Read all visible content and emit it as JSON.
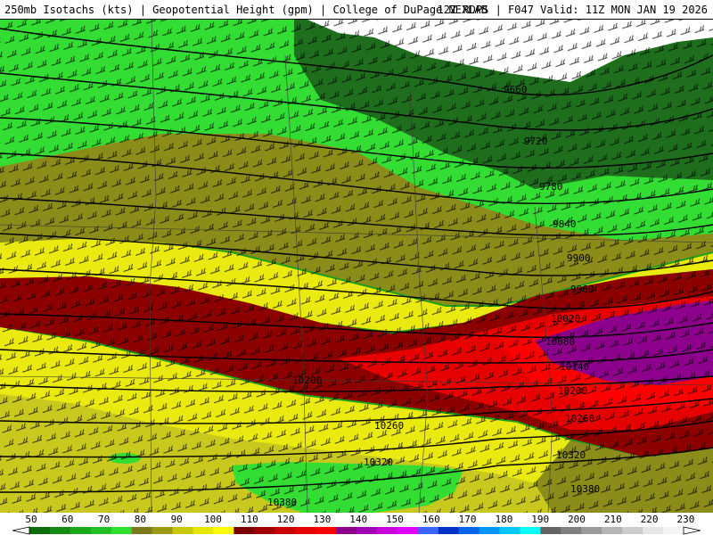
{
  "header": {
    "title_left": "250mb Isotachs (kts) | Geopotential Height (gpm) | College of DuPage NEXLAB",
    "title_right": "12Z RDPS | F047 Valid: 11Z MON JAN 19 2026"
  },
  "colorbar": {
    "ticks": [
      "50",
      "60",
      "70",
      "80",
      "90",
      "100",
      "110",
      "120",
      "130",
      "140",
      "150",
      "160",
      "170",
      "180",
      "190",
      "200",
      "210",
      "220",
      "230"
    ],
    "colors": [
      "#0a6e0a",
      "#128c12",
      "#1aa81a",
      "#22c022",
      "#2ee02e",
      "#7a7a1a",
      "#9a9a10",
      "#c8c808",
      "#e6e600",
      "#ffff00",
      "#7a0000",
      "#a00000",
      "#c80000",
      "#e60000",
      "#ff0000",
      "#8c008c",
      "#a000b4",
      "#c800dc",
      "#e100ff",
      "#3c64ff",
      "#0032c8",
      "#0064e6",
      "#0096ff",
      "#00c8ff",
      "#00ffff",
      "#646464",
      "#808080",
      "#9a9a9a",
      "#b4b4b4",
      "#cccccc",
      "#e6e6e6",
      "#f4f4f4"
    ]
  },
  "contour_labels": [
    "9660",
    "9720",
    "9780",
    "9840",
    "9900",
    "9960",
    "10020",
    "10080",
    "10140",
    "10200",
    "10260",
    "10320",
    "10380",
    "10200",
    "10260",
    "10320",
    "10380"
  ],
  "fill_colors": {
    "dark_green": "#1e6e1e",
    "mid_green": "#1aa01a",
    "bright_green": "#33dd33",
    "olive": "#8c8c1a",
    "yellow_olive": "#c8c81e",
    "yellow": "#eaea10",
    "dark_red": "#8c0000",
    "red": "#d20000",
    "bright_red": "#ff0000",
    "purple": "#8c008c",
    "no_data": "#ffffff"
  }
}
